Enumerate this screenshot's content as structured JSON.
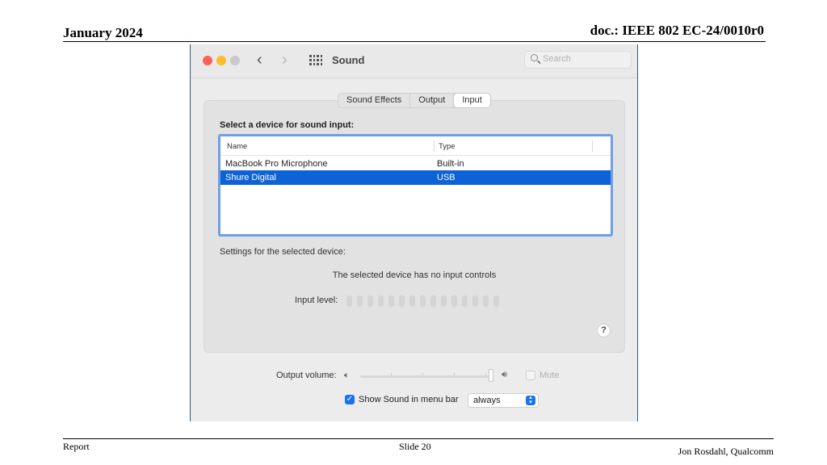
{
  "slide": {
    "date": "January 2024",
    "doc": "doc.: IEEE 802 EC-24/0010r0",
    "footer_left": "Report",
    "footer_center": "Slide 20",
    "footer_right": "Jon Rosdahl, Qualcomm"
  },
  "window": {
    "title": "Sound",
    "search_placeholder": "Search"
  },
  "tabs": [
    {
      "label": "Sound Effects",
      "active": false
    },
    {
      "label": "Output",
      "active": false
    },
    {
      "label": "Input",
      "active": true
    }
  ],
  "input": {
    "heading": "Select a device for sound input:",
    "columns": [
      "Name",
      "Type"
    ],
    "devices": [
      {
        "name": "MacBook Pro Microphone",
        "type": "Built-in",
        "selected": false
      },
      {
        "name": "Shure Digital",
        "type": "USB",
        "selected": true
      }
    ],
    "settings_label": "Settings for the selected device:",
    "no_controls_text": "The selected device has no input controls",
    "input_level_label": "Input level:",
    "input_level": 0,
    "help": "?"
  },
  "output_volume": {
    "label": "Output volume:",
    "level": 1.0,
    "mute_label": "Mute",
    "muted": false
  },
  "menu_bar": {
    "label": "Show Sound in menu bar",
    "checked": true,
    "select_value": "always"
  },
  "colors": {
    "selection": "#0d62d6",
    "accent": "#1a73e8",
    "table_focus_ring": "#6f9ee8"
  }
}
